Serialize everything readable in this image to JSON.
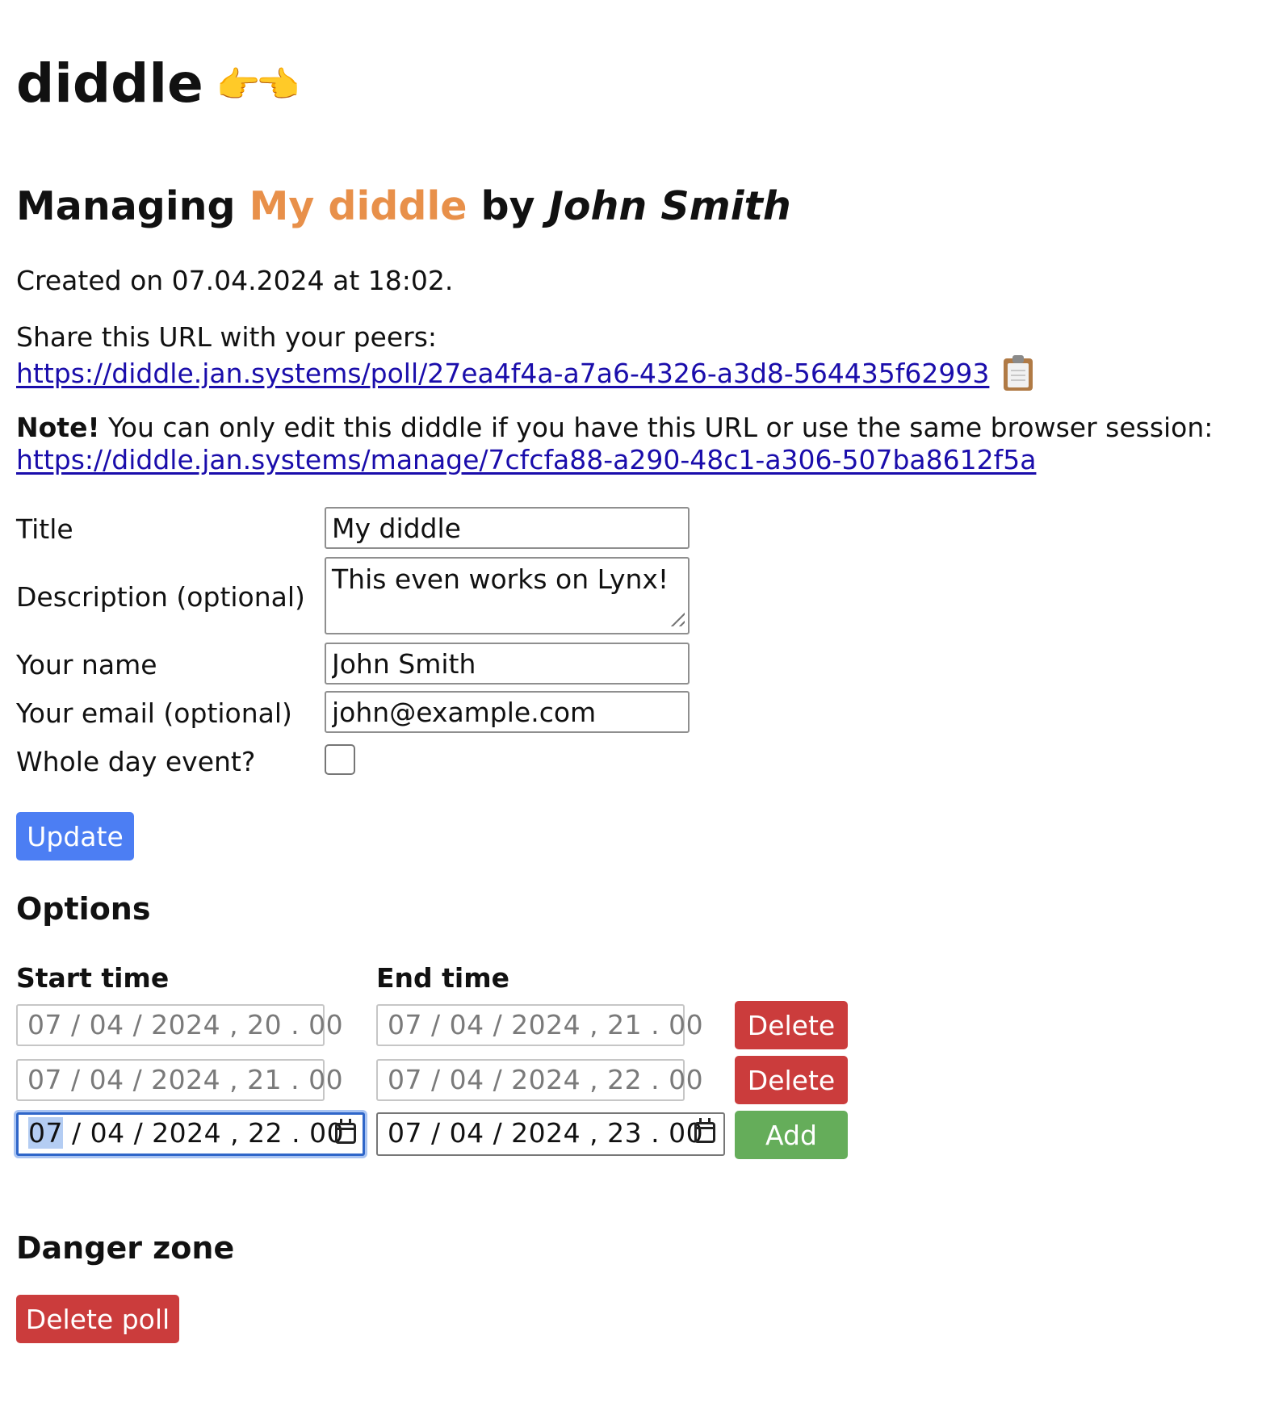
{
  "app": {
    "title": "diddle",
    "title_emoji": "👉👈"
  },
  "poll": {
    "heading_prefix": "Managing",
    "title": "My diddle",
    "heading_by": "by",
    "author": "John Smith",
    "created_text": "Created on 07.04.2024 at 18:02.",
    "share_label": "Share this URL with your peers:",
    "share_url": "https://diddle.jan.systems/poll/27ea4f4a-a7a6-4326-a3d8-564435f62993",
    "copy_icon": "clipboard-icon",
    "note_bold": "Note!",
    "note_text": " You can only edit this diddle if you have this URL or use the same browser session:",
    "manage_url": "https://diddle.jan.systems/manage/7cfcfa88-a290-48c1-a306-507ba8612f5a"
  },
  "form": {
    "title_label": "Title",
    "title_value": "My diddle",
    "description_label": "Description (optional)",
    "description_value": "This even works on Lynx!",
    "name_label": "Your name",
    "name_value": "John Smith",
    "email_label": "Your email (optional)",
    "email_value": "john@example.com",
    "whole_day_label": "Whole day event?",
    "whole_day_checked": false,
    "update_label": "Update"
  },
  "options": {
    "heading": "Options",
    "start_header": "Start time",
    "end_header": "End time",
    "rows": [
      {
        "start": "07 / 04 / 2024 ,  20 . 00",
        "end": "07 / 04 / 2024 ,  21 . 00",
        "action": "Delete"
      },
      {
        "start": "07 / 04 / 2024 ,  21 . 00",
        "end": "07 / 04 / 2024 ,  22 . 00",
        "action": "Delete"
      }
    ],
    "new_row": {
      "start_day": "07",
      "start_rest": " / 04 / 2024 ,  22 . 00",
      "end": "07 / 04 / 2024 ,  23 . 00",
      "action": "Add",
      "calendar_icon": "calendar-icon"
    }
  },
  "danger": {
    "heading": "Danger zone",
    "delete_poll_label": "Delete poll"
  },
  "colors": {
    "accent": "#e8904a",
    "link": "#1a0dab",
    "primary_button": "#4c7ef3",
    "danger_button": "#cb3c3c",
    "add_button": "#65ad5a",
    "focus_ring": "#2f66c9"
  }
}
